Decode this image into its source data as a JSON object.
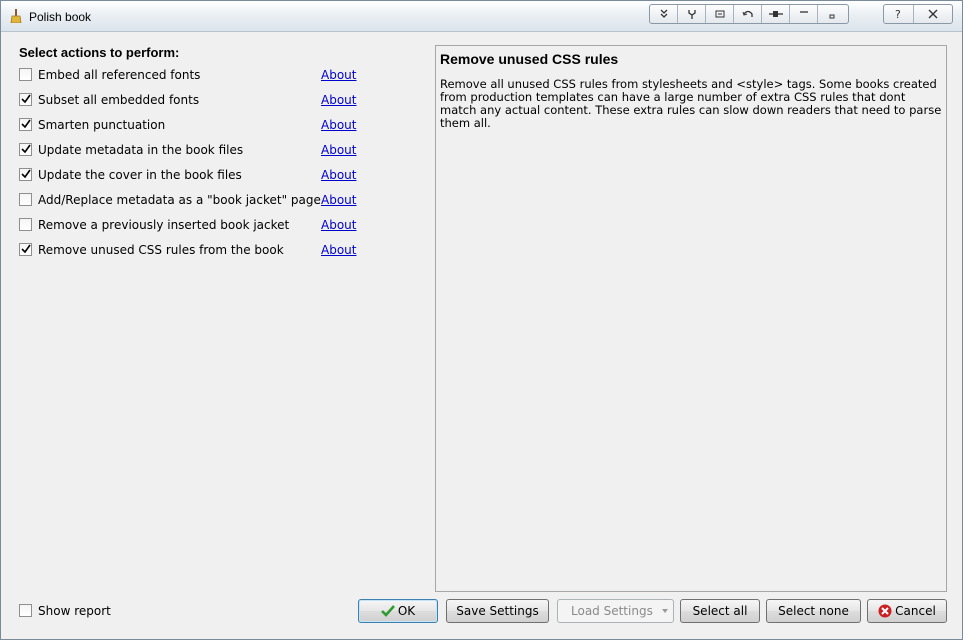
{
  "window": {
    "title": "Polish book"
  },
  "left": {
    "heading": "Select actions to perform:",
    "actions": [
      {
        "label": "Embed all referenced fonts",
        "checked": false,
        "about": "About"
      },
      {
        "label": "Subset all embedded fonts",
        "checked": true,
        "about": "About"
      },
      {
        "label": "Smarten punctuation",
        "checked": true,
        "about": "About"
      },
      {
        "label": "Update metadata in the book files",
        "checked": true,
        "about": "About"
      },
      {
        "label": "Update the cover in the book files",
        "checked": true,
        "about": "About"
      },
      {
        "label": "Add/Replace metadata as a \"book jacket\" page",
        "checked": false,
        "about": "About"
      },
      {
        "label": "Remove a previously inserted book jacket",
        "checked": false,
        "about": "About"
      },
      {
        "label": "Remove unused CSS rules from the book",
        "checked": true,
        "about": "About"
      }
    ]
  },
  "description": {
    "title": "Remove unused CSS rules",
    "body": "Remove all unused CSS rules from stylesheets and <style> tags. Some books created from production templates can have a large number of extra CSS rules that dont match any actual content. These extra rules can slow down readers that need to parse them all."
  },
  "footer": {
    "show_report_label": "Show report",
    "show_report_checked": false,
    "buttons": {
      "ok": "OK",
      "save_settings": "Save Settings",
      "load_settings": "Load Settings",
      "select_all": "Select all",
      "select_none": "Select none",
      "cancel": "Cancel"
    }
  },
  "titlebar_icons": [
    "collapse-icon",
    "pin-icon",
    "window-icon",
    "undo-icon",
    "plug-icon",
    "minimize-icon",
    "restore-icon",
    "help-icon",
    "close-icon"
  ],
  "colors": {
    "link": "#0000cc",
    "ok_check": "#2e9b2e",
    "cancel_icon": "#cc2020"
  }
}
